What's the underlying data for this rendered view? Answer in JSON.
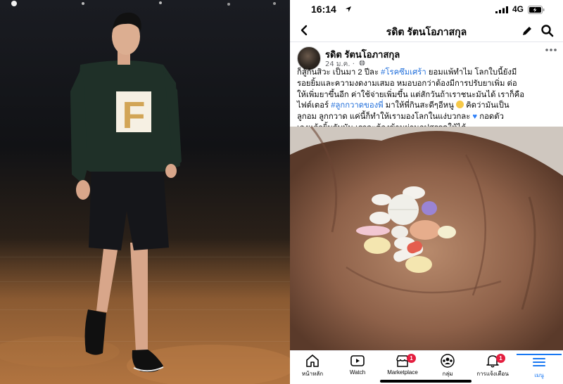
{
  "status_bar": {
    "time": "16:14",
    "network": "4G",
    "icons": [
      "location-arrow-icon",
      "signal-bars-icon",
      "battery-charging-icon"
    ]
  },
  "nav": {
    "title": "รดิต รัตนโอภาสกุล",
    "icons": [
      "back-chevron-icon",
      "edit-pencil-icon",
      "search-icon"
    ]
  },
  "post": {
    "author": "รดิต รัตนโอภาสกุล",
    "date": "24 ม.ค. ·",
    "lines": [
      [
        {
          "t": "ก็สู้กันสิวะ เป็นมา 2 ปีละ "
        },
        {
          "t": "#โรคซึมเศร้า",
          "tag": true
        },
        {
          "t": " ยอมแพ้ทำไม โลกใบนี้ยังมี"
        }
      ],
      [
        {
          "t": "รอยยิ้มและความงดงามเสมอ หมอบอกว่าต้องมีการปรับยาเพิ่ม ต่อ"
        }
      ],
      [
        {
          "t": "ให้เพิ่มยาขึ้นอีก ค่าใช้จ่ายเพิ่มขึ้น แต่สักวันถ้าเราชนะมันได้ เราก็คือ"
        }
      ],
      [
        {
          "t": "ไฟต์เตอร์ "
        },
        {
          "t": "#ลูกกวาดของพี่",
          "tag": true
        },
        {
          "t": " มาให้พี่กินสะดีๆอีหนู "
        },
        {
          "emoji": "smile"
        },
        {
          "t": " คิดว่ามันเป็น"
        }
      ],
      [
        {
          "t": "ลูกอม ลูกกวาด แค่นี้ก็ทำให้เรามองโลกในแง่บวกละ "
        },
        {
          "emoji": "blue-heart"
        },
        {
          "t": " กอดตัว"
        }
      ],
      [
        {
          "t": "เองแล้วยิ้มกับมัน เราจะต้องข้ามผ่านอุปสรรคให้ได้"
        }
      ]
    ]
  },
  "tabs": [
    {
      "label": "หน้าหลัก",
      "icon": "home-icon",
      "badge": ""
    },
    {
      "label": "Watch",
      "icon": "watch-video-icon",
      "badge": ""
    },
    {
      "label": "Marketplace",
      "icon": "marketplace-shop-icon",
      "badge": "1"
    },
    {
      "label": "กลุ่ม",
      "icon": "groups-icon",
      "badge": ""
    },
    {
      "label": "การแจ้งเตือน",
      "icon": "notification-bell-icon",
      "badge": "1"
    },
    {
      "label": "เมนู",
      "icon": "menu-hamburger-icon",
      "badge": "",
      "active": true
    }
  ],
  "colors": {
    "link": "#216fdb",
    "accent": "#1877f2",
    "badge": "#e41e3f",
    "sweater": "#1f3028",
    "sweater_letter": "#d2a556"
  },
  "left_photo": {
    "sweater_letter": "F"
  }
}
